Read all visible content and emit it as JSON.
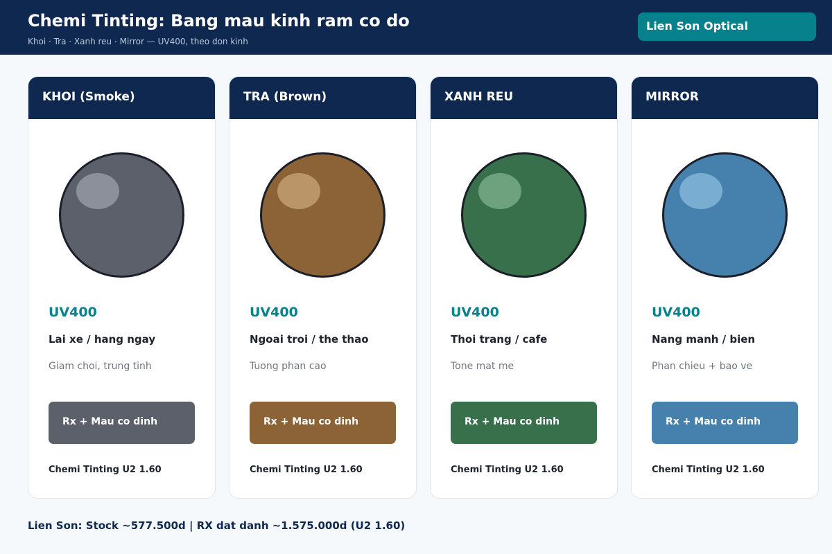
{
  "header": {
    "title": "Chemi Tinting: Bang mau kinh ram co do",
    "subtitle": "Khoi · Tra · Xanh reu · Mirror — UV400, theo don kinh",
    "brand": "Lien Son Optical"
  },
  "cards": [
    {
      "name": "KHOI (Smoke)",
      "uv": "UV400",
      "use": "Lai xe / hang ngay",
      "desc": "Giam choi, trung tinh",
      "button": "Rx + Mau co dinh",
      "product": "Chemi Tinting U2 1.60",
      "color": "#5b606a",
      "highlight": "#c8ccd4"
    },
    {
      "name": "TRA (Brown)",
      "uv": "UV400",
      "use": "Ngoai troi / the thao",
      "desc": "Tuong phan cao",
      "button": "Rx + Mau co dinh",
      "product": "Chemi Tinting U2 1.60",
      "color": "#8b6336",
      "highlight": "#f3d3a3"
    },
    {
      "name": "XANH REU",
      "uv": "UV400",
      "use": "Thoi trang / cafe",
      "desc": "Tone mat me",
      "button": "Rx + Mau co dinh",
      "product": "Chemi Tinting U2 1.60",
      "color": "#37704b",
      "highlight": "#b1dfbd"
    },
    {
      "name": "MIRROR",
      "uv": "UV400",
      "use": "Nang manh / bien",
      "desc": "Phan chieu + bao ve",
      "button": "Rx + Mau co dinh",
      "product": "Chemi Tinting U2 1.60",
      "color": "#4681ad",
      "highlight": "#b9e4ff"
    }
  ],
  "footer": "Lien Son: Stock ~577.500d | RX dat danh ~1.575.000d (U2 1.60)"
}
